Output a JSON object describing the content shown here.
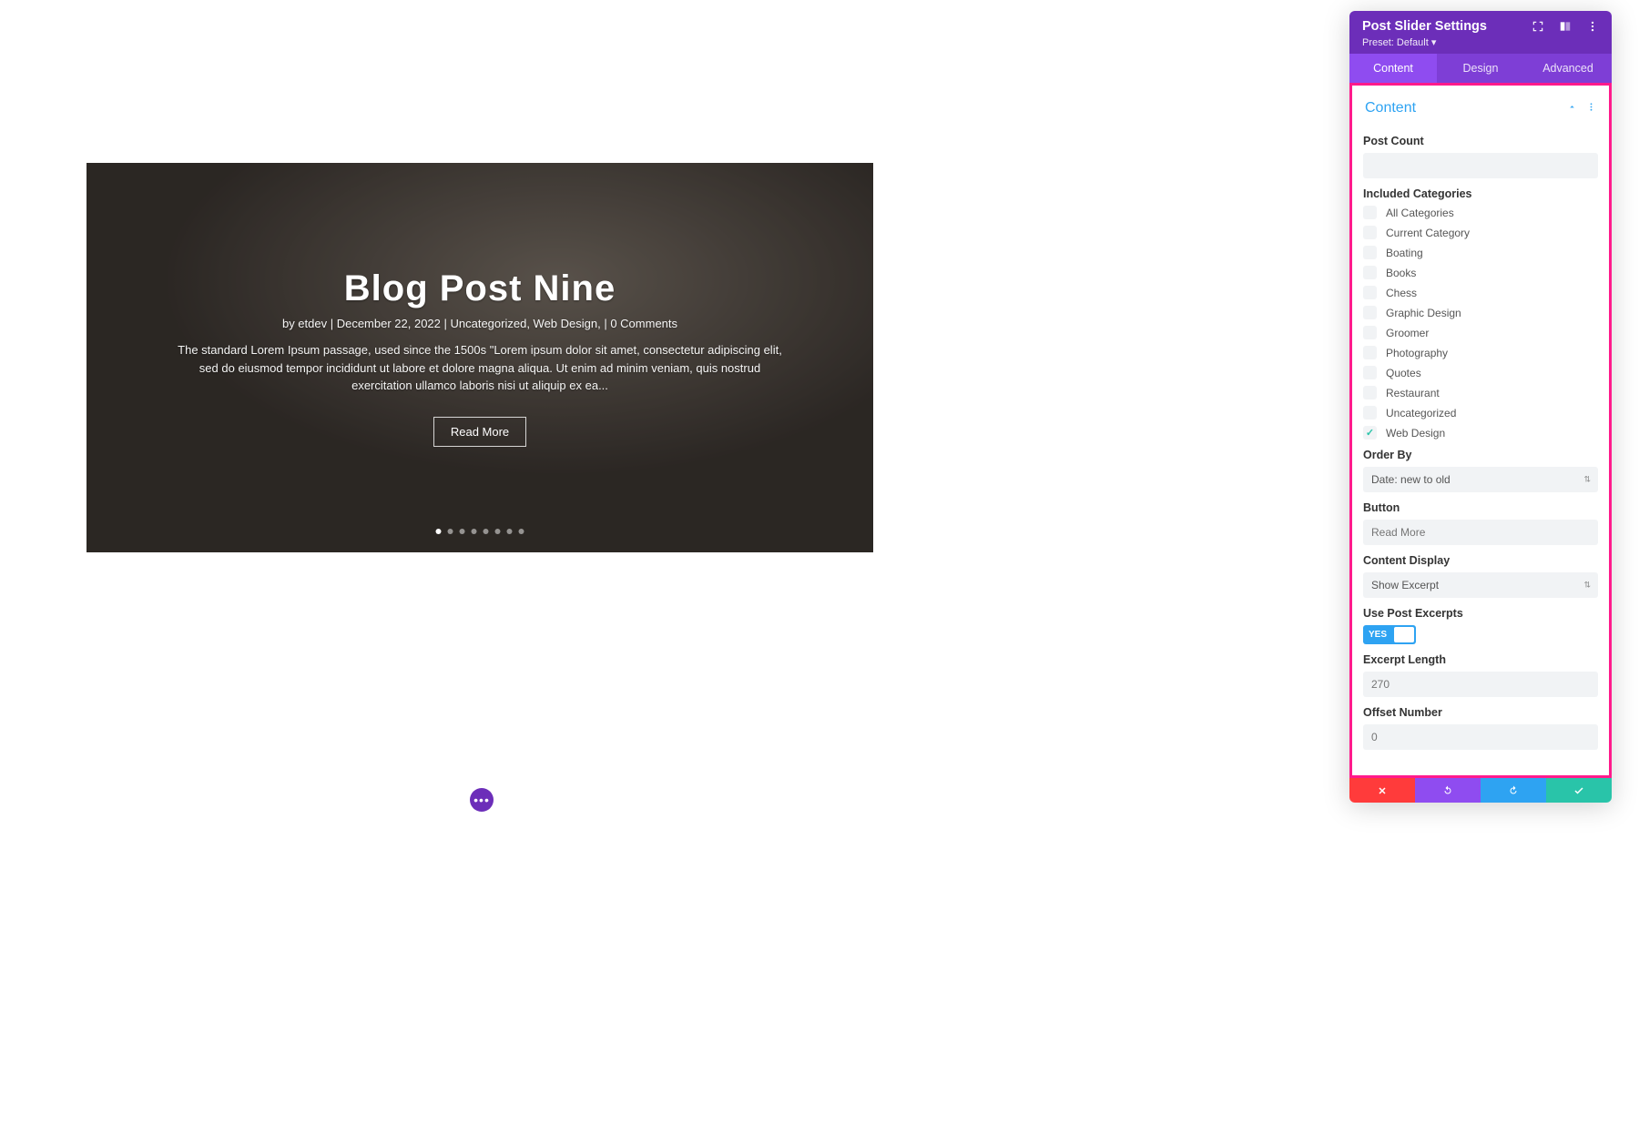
{
  "slider": {
    "title": "Blog Post Nine",
    "meta": "by etdev | December 22, 2022 | Uncategorized, Web Design, | 0 Comments",
    "excerpt": "The standard Lorem Ipsum passage, used since the 1500s \"Lorem ipsum dolor sit amet, consectetur adipiscing elit, sed do eiusmod tempor incididunt ut labore et dolore magna aliqua. Ut enim ad minim veniam, quis nostrud exercitation ullamco laboris nisi ut aliquip ex ea...",
    "button_label": "Read More",
    "dot_count": 8,
    "active_dot": 0
  },
  "panel": {
    "title": "Post Slider Settings",
    "preset_label": "Preset: Default",
    "tabs": [
      "Content",
      "Design",
      "Advanced"
    ],
    "active_tab": 0,
    "section_title": "Content",
    "fields": {
      "post_count_label": "Post Count",
      "post_count_value": "",
      "included_categories_label": "Included Categories",
      "categories": [
        {
          "label": "All Categories",
          "checked": false
        },
        {
          "label": "Current Category",
          "checked": false
        },
        {
          "label": "Boating",
          "checked": false
        },
        {
          "label": "Books",
          "checked": false
        },
        {
          "label": "Chess",
          "checked": false
        },
        {
          "label": "Graphic Design",
          "checked": false
        },
        {
          "label": "Groomer",
          "checked": false
        },
        {
          "label": "Photography",
          "checked": false
        },
        {
          "label": "Quotes",
          "checked": false
        },
        {
          "label": "Restaurant",
          "checked": false
        },
        {
          "label": "Uncategorized",
          "checked": false
        },
        {
          "label": "Web Design",
          "checked": true
        }
      ],
      "order_by_label": "Order By",
      "order_by_value": "Date: new to old",
      "button_label": "Button",
      "button_placeholder": "Read More",
      "content_display_label": "Content Display",
      "content_display_value": "Show Excerpt",
      "use_post_excerpts_label": "Use Post Excerpts",
      "use_post_excerpts_toggle": "YES",
      "excerpt_length_label": "Excerpt Length",
      "excerpt_length_placeholder": "270",
      "offset_number_label": "Offset Number",
      "offset_number_placeholder": "0"
    }
  }
}
